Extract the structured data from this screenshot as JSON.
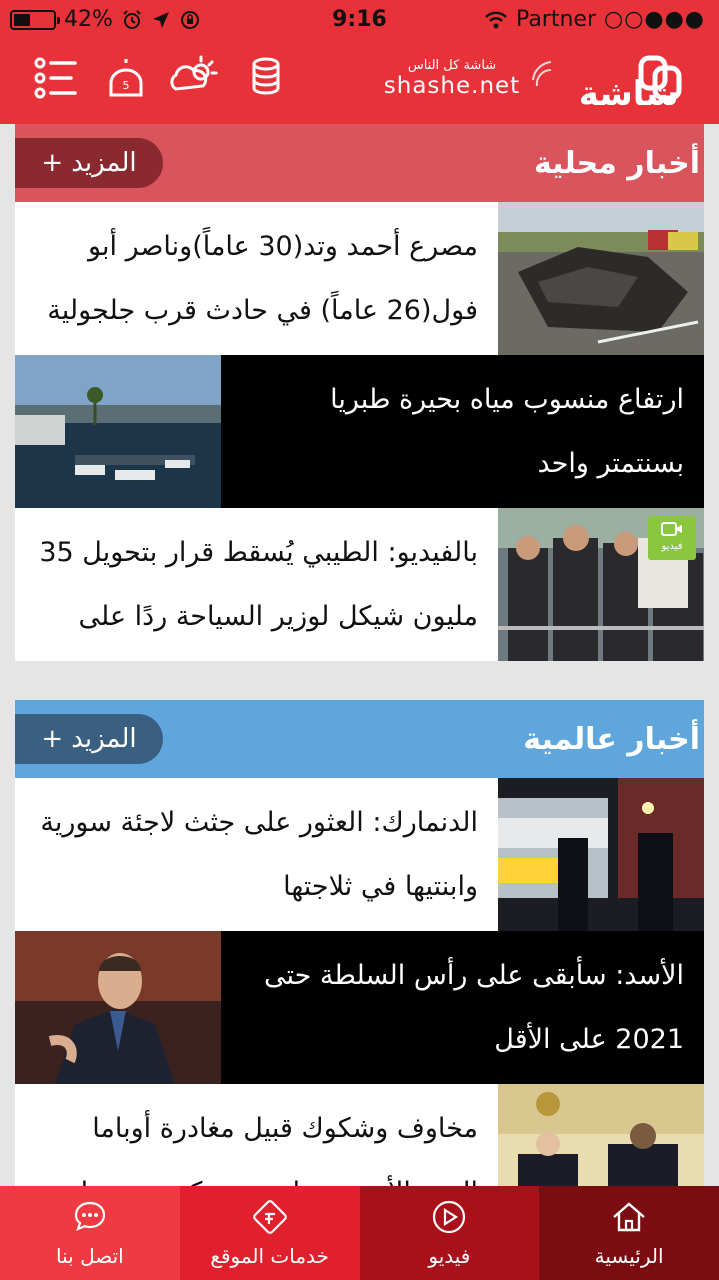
{
  "status_bar": {
    "battery": "42%",
    "battery_level": 0.42,
    "time": "9:16",
    "carrier": "Partner",
    "signal_dots": "○○●●●"
  },
  "header": {
    "brand_tagline": "شاشة كل الناس",
    "brand_domain": "shashe.net",
    "logo_text": "شاشة",
    "icons": [
      "menu-icon",
      "mosque-icon",
      "weather-icon",
      "coins-icon"
    ]
  },
  "sections": [
    {
      "title": "أخبار محلية",
      "more_label": "المزيد",
      "header_color": "#d9545c",
      "items": [
        {
          "title": "مصرع أحمد وتد(30 عاماً)وناصر أبو فول(26 عاماً) في حادث قرب جلجولية",
          "style": "white",
          "image": "car-crash-photo"
        },
        {
          "title": "ارتفاع منسوب مياه بحيرة طبريا بسنتمتر واحد",
          "style": "black",
          "image": "lake-harbor-photo"
        },
        {
          "title": "بالفيديو: الطيبي يُسقط قرار بتحويل 35 مليون شيكل لوزير السياحة ردًا على",
          "style": "white",
          "image": "crowd-prayer-photo",
          "badge": "فيديو"
        }
      ]
    },
    {
      "title": "أخبار عالمية",
      "more_label": "المزيد",
      "header_color": "#5fa6dc",
      "items": [
        {
          "title": "الدنمارك: العثور على جثث لاجئة سورية وابنتيها في ثلاجتها",
          "style": "white",
          "image": "police-night-photo"
        },
        {
          "title": "الأسد: سأبقى على رأس السلطة حتى 2021 على الأقل",
          "style": "black",
          "image": "assad-portrait-photo"
        },
        {
          "title": "مخاوف وشكوك قبيل مغادرة أوباما البيت الأبيض حول مصير كرسي نتنياهو",
          "style": "white",
          "image": "oval-office-photo"
        }
      ]
    }
  ],
  "tabbar": [
    {
      "label": "اتصل بنا",
      "icon": "chat-icon",
      "color": "#ef3a44"
    },
    {
      "label": "خدمات الموقع",
      "icon": "services-icon",
      "color": "#e0202c"
    },
    {
      "label": "فيديو",
      "icon": "play-icon",
      "color": "#a8101a"
    },
    {
      "label": "الرئيسية",
      "icon": "home-icon",
      "color": "#7a0c12",
      "active": true
    }
  ]
}
